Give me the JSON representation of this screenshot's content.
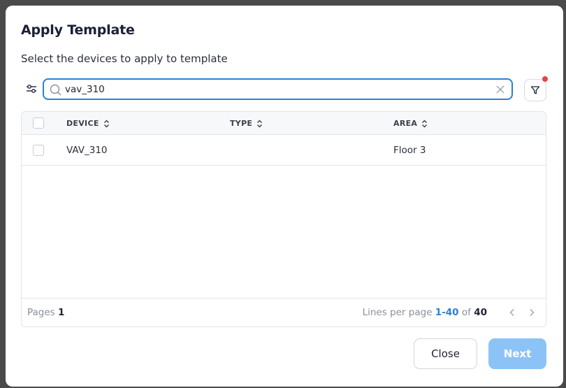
{
  "dialog": {
    "title": "Apply Template",
    "subtitle": "Select the devices to apply to template"
  },
  "search": {
    "value": "vav_310",
    "placeholder": ""
  },
  "table": {
    "columns": [
      "DEVICE",
      "TYPE",
      "AREA"
    ],
    "rows": [
      {
        "device": "VAV_310",
        "type": "",
        "area": "Floor 3"
      }
    ]
  },
  "footer": {
    "pages_label": "Pages",
    "pages_value": "1",
    "lines_label": "Lines per page",
    "lines_range": "1-40",
    "lines_of": "of",
    "lines_total": "40"
  },
  "buttons": {
    "close": "Close",
    "next": "Next"
  },
  "colors": {
    "accent": "#2d7fd4",
    "next_disabled": "#8cc3f7",
    "filter_badge": "#e24545"
  },
  "icons": {
    "adjust": "sliders-icon",
    "search": "search-icon",
    "clear": "close-icon",
    "filter": "filter-icon",
    "sort": "sort-icon",
    "prev": "chevron-left-icon",
    "next": "chevron-right-icon"
  }
}
